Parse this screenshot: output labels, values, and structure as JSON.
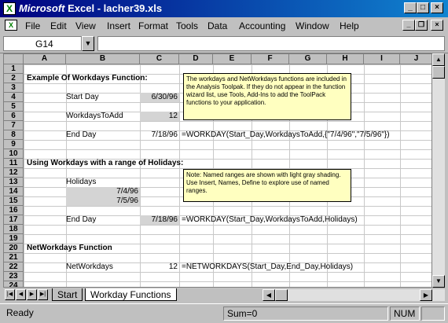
{
  "window": {
    "brand": "Microsoft",
    "title_rest": " Excel - lacher39.xls"
  },
  "menu": [
    "File",
    "Edit",
    "View",
    "Insert",
    "Format",
    "Tools",
    "Data",
    "Accounting",
    "Window",
    "Help"
  ],
  "formula_bar": {
    "cell_ref": "G14",
    "formula": ""
  },
  "columns": [
    "A",
    "B",
    "C",
    "D",
    "E",
    "F",
    "G",
    "H",
    "I",
    "J"
  ],
  "rows": [
    "1",
    "2",
    "3",
    "4",
    "5",
    "6",
    "7",
    "8",
    "9",
    "10",
    "11",
    "12",
    "13",
    "14",
    "15",
    "16",
    "17",
    "18",
    "19",
    "20",
    "21",
    "22",
    "23",
    "24"
  ],
  "cells": {
    "heading1": "Example Of Workdays Function:",
    "start_day_label": "Start Day",
    "start_day_value": "6/30/96",
    "workdays_label": "WorkdaysToAdd",
    "workdays_value": "12",
    "end_day_label": "End Day",
    "end_day_value": "7/18/96",
    "formula1": "=WORKDAY(Start_Day,WorkdaysToAdd,{\"7/4/96\",\"7/5/96\"})",
    "heading2": "Using Workdays with a range of Holidays:",
    "holidays_label": "Holidays",
    "holiday1": "7/4/96",
    "holiday2": "7/5/96",
    "end_day2_label": "End Day",
    "end_day2_value": "7/18/96",
    "formula2": "=WORKDAY(Start_Day,WorkdaysToAdd,Holidays)",
    "heading3": "NetWorkdays Function",
    "networkdays_label": "NetWorkdays",
    "networkdays_value": "12",
    "formula3": "=NETWORKDAYS(Start_Day,End_Day,Holidays)"
  },
  "notes": {
    "note1": "The workdays and NetWorkdays functions are included in the Analysis Toolpak. If they do not appear in the function wizard list, use Tools, Add-Ins to add the ToolPack functions to your application.",
    "note2": "Note: Named ranges are shown with light gray shading. Use Insert, Names, Define to explore use of named ranges."
  },
  "tabs": [
    "Start",
    "Workday Functions"
  ],
  "status": {
    "ready": "Ready",
    "sum": "Sum=0",
    "num": "NUM"
  },
  "colors": {
    "titlebar": "#000080",
    "note_bg": "#ffffc0",
    "named_range": "#d4d4d4"
  }
}
